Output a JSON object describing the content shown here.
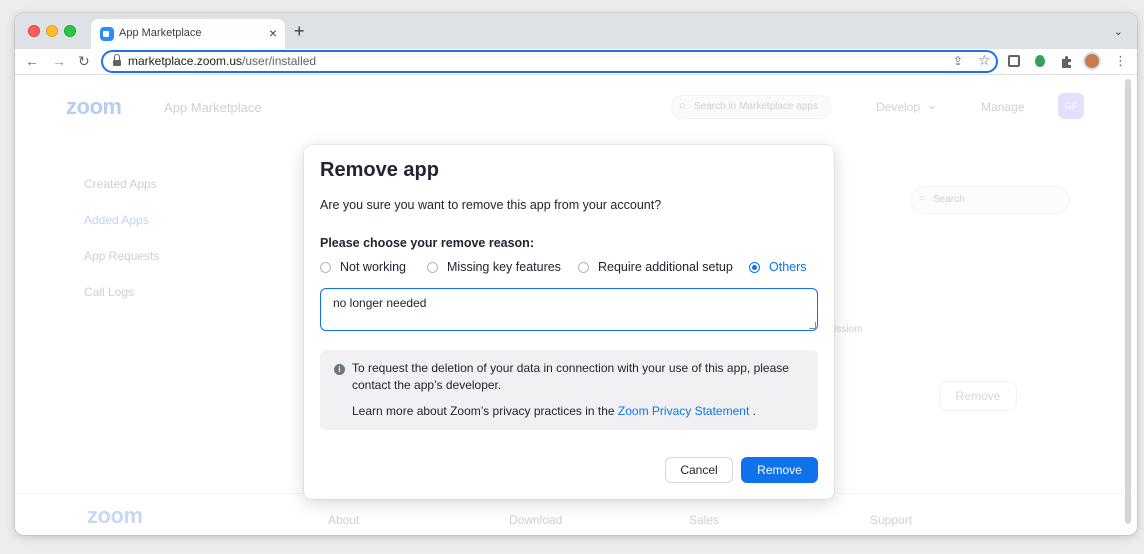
{
  "browser": {
    "tab_title": "App Marketplace",
    "tab_close": "×",
    "new_tab": "+",
    "tab_menu": "⌄",
    "url_host": "marketplace.zoom.us",
    "url_path": "/user/installed",
    "back": "←",
    "forward": "→",
    "reload": "↻",
    "share_icon": "⇪",
    "star_icon": "☆",
    "menu_icon": "⋮"
  },
  "background_page": {
    "logo": "zoom",
    "marketplace_title": "App Marketplace",
    "search_placeholder": "Search in Marketplace apps",
    "develop": "Develop",
    "develop_chevron": "⌄",
    "manage": "Manage",
    "user_initials": "GF",
    "sidebar": [
      "Created Apps",
      "Added Apps",
      "App Requests",
      "Call Logs"
    ],
    "content_search": "Search",
    "permission_text": "issiom",
    "remove_button": "Remove",
    "footer_logo": "zoom",
    "footer_links": [
      "About",
      "Download",
      "Sales",
      "Support"
    ]
  },
  "modal": {
    "title": "Remove app",
    "question": "Are you sure you want to remove this app from your account?",
    "reason_label": "Please choose your remove reason:",
    "reasons": [
      {
        "label": "Not working",
        "checked": false
      },
      {
        "label": "Missing key features",
        "checked": false
      },
      {
        "label": "Require additional setup",
        "checked": false
      },
      {
        "label": "Others",
        "checked": true
      }
    ],
    "reason_text_value": "no longer needed",
    "info_icon": "i",
    "info_text": "To request the deletion of your data in connection with your use of this app, please contact the app’s developer.",
    "learn_prefix": "Learn more about Zoom’s privacy practices in the ",
    "learn_link": "Zoom Privacy Statement",
    "learn_suffix": " .",
    "cancel_label": "Cancel",
    "remove_label": "Remove"
  },
  "colors": {
    "accent": "#0e72ed",
    "omnibox_border": "#1a73e8"
  }
}
